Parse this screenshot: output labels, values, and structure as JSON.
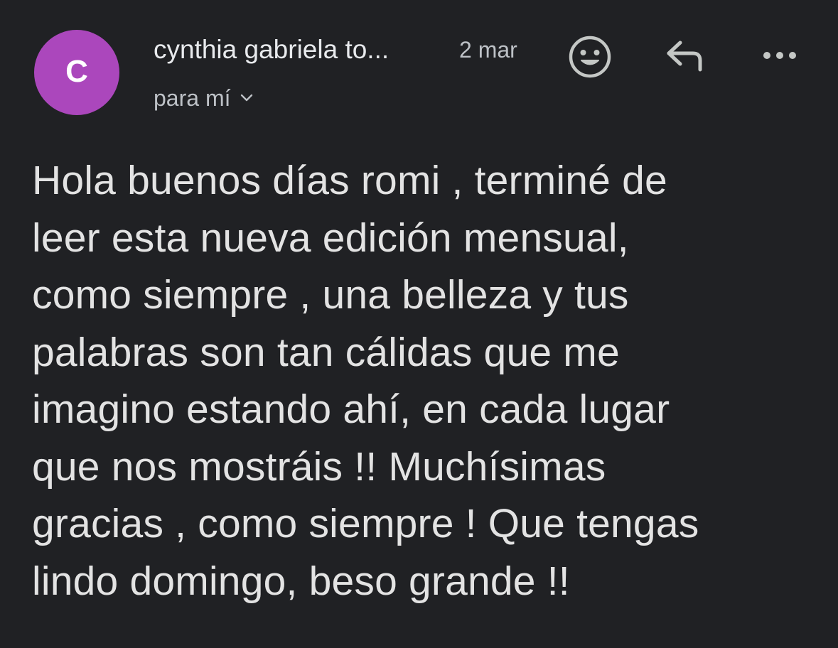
{
  "header": {
    "avatar_letter": "C",
    "sender_name": "cynthia gabriela to...",
    "date": "2 mar",
    "recipient_label": "para mí",
    "icons": {
      "emoji": "emoji-reaction-icon",
      "reply": "reply-icon",
      "more": "more-options-icon",
      "expand": "chevron-down-icon"
    }
  },
  "colors": {
    "background": "#202124",
    "avatar": "#ab47bc",
    "text": "#e3e3e3",
    "secondary_text": "#bdc1c6"
  },
  "message": {
    "lines": [
      "Hola buenos días romi , terminé de",
      "leer esta nueva edición mensual,",
      "como siempre , una belleza y tus",
      "palabras son tan cálidas que me",
      "imagino estando ahí, en cada lugar",
      "que nos mostráis !! Muchísimas",
      "gracias , como siempre ! Que tengas",
      "lindo domingo, beso grande !!"
    ]
  }
}
